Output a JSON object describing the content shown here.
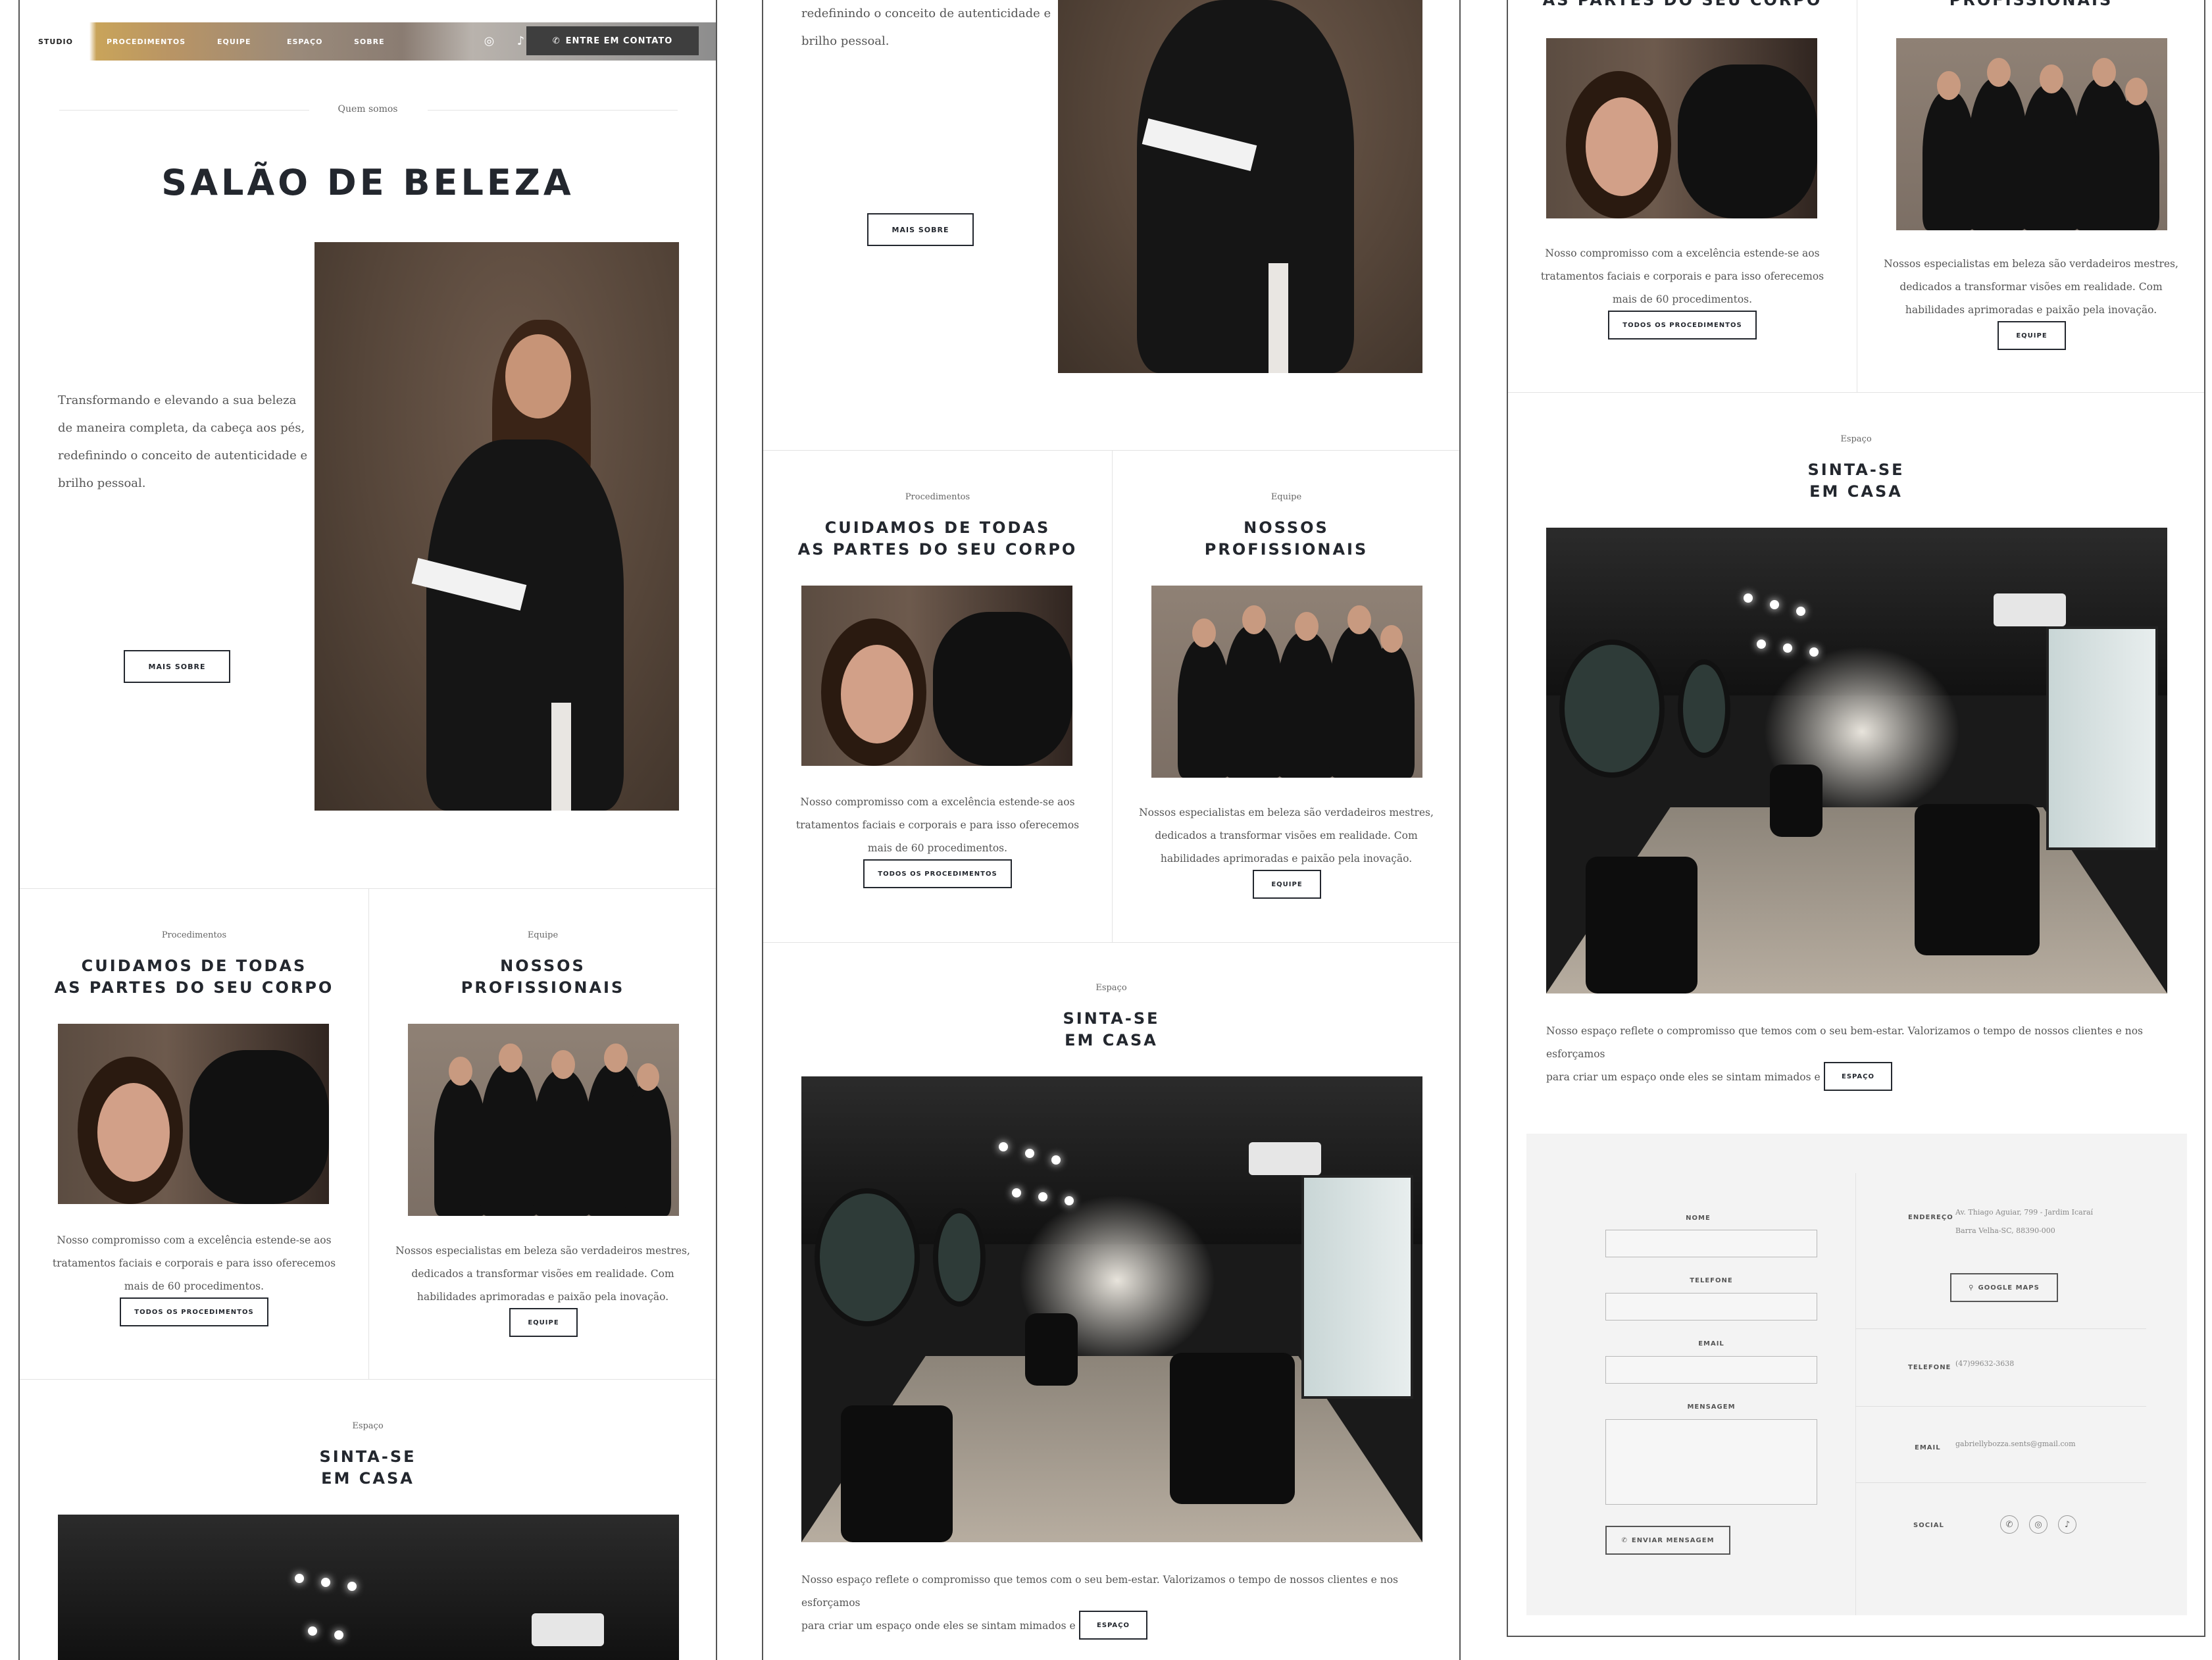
{
  "nav": {
    "brand": "STUDIO",
    "items": [
      "PROCEDIMENTOS",
      "EQUIPE",
      "ESPAÇO",
      "SOBRE"
    ],
    "instagram_icon": "instagram-icon",
    "tiktok_icon": "tiktok-icon",
    "cta_label": "ENTRE EM CONTATO",
    "cta_icon": "whatsapp-icon"
  },
  "about": {
    "kicker": "Quem somos",
    "title": "SALÃO DE BELEZA",
    "text_lines": [
      "Transformando e elevando a sua beleza",
      "de maneira completa, da cabeça aos pés,",
      "redefinindo o conceito de autenticidade e",
      "brilho pessoal."
    ],
    "text_tail": [
      "redefinindo o conceito de autenticidade e",
      "brilho pessoal."
    ],
    "button": "MAIS SOBRE"
  },
  "procedures": {
    "kicker": "Procedimentos",
    "title_line1": "CUIDAMOS DE TODAS",
    "title_line2": "AS PARTES DO SEU CORPO",
    "text_lines": [
      "Nosso compromisso com a excelência estende-se aos",
      "tratamentos faciais e corporais e para isso oferecemos",
      "mais de 60 procedimentos."
    ],
    "button": "TODOS OS PROCEDIMENTOS"
  },
  "team": {
    "kicker": "Equipe",
    "title_line1": "NOSSOS",
    "title_line2": "PROFISSIONAIS",
    "text_lines": [
      "Nossos especialistas em beleza são verdadeiros mestres,",
      "dedicados a transformar visões em realidade. Com",
      "habilidades aprimoradas e paixão pela inovação."
    ],
    "button": "EQUIPE"
  },
  "space": {
    "kicker": "Espaço",
    "title_line1": "SINTA-SE",
    "title_line2": "EM CASA",
    "text_lines": [
      "Nosso espaço reflete o compromisso que temos com o seu bem-estar. Valorizamos o tempo de nossos clientes e nos esforçamos",
      "para criar um espaço onde eles se sintam mimados e apreciados."
    ],
    "button": "ESPAÇO"
  },
  "contact": {
    "form": {
      "name_label": "NOME",
      "phone_label": "TELEFONE",
      "email_label": "EMAIL",
      "message_label": "MENSAGEM",
      "submit": "ENVIAR MENSAGEM"
    },
    "address_label": "ENDEREÇO",
    "address_line1": "Av. Thiago Aguiar, 799 - Jardim Icaraí",
    "address_line2": "Barra Velha-SC, 88390-000",
    "maps_button": "GOOGLE MAPS",
    "phone_label": "TELEFONE",
    "phone_value": "(47)99632-3638",
    "email_label": "EMAIL",
    "email_value": "gabriellybozza.sents@gmail.com",
    "social_label": "SOCIAL"
  }
}
